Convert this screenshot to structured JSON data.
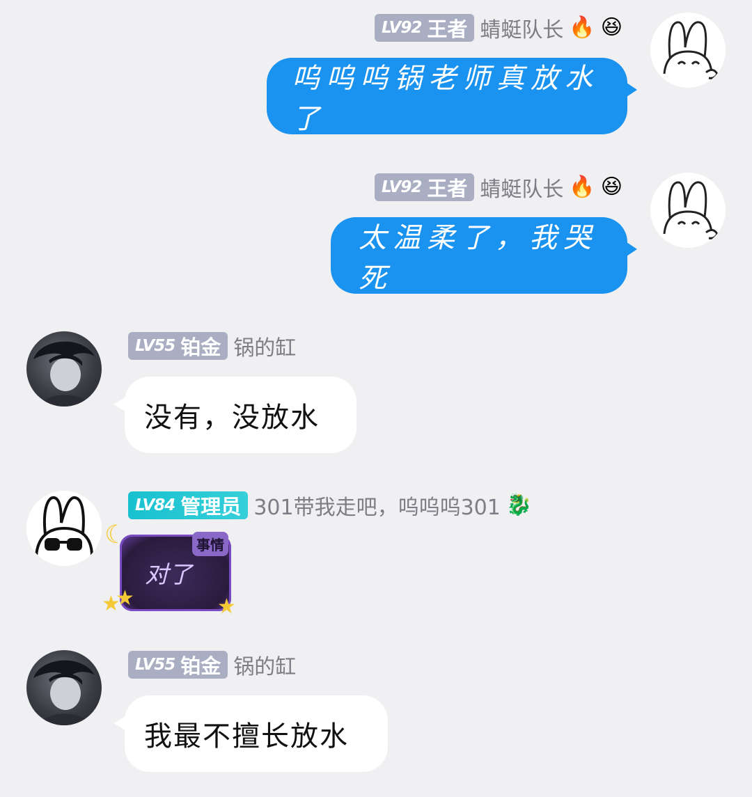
{
  "messages": [
    {
      "sender": {
        "level": "LV92",
        "rank": "王者",
        "nickname": "蜻蜓队长",
        "emojis": [
          "🔥",
          "😆"
        ],
        "avatar_icon": "bunny-avatar-icon"
      },
      "text": "呜呜呜锅老师真放水了",
      "direction": "outgoing"
    },
    {
      "sender": {
        "level": "LV92",
        "rank": "王者",
        "nickname": "蜻蜓队长",
        "emojis": [
          "🔥",
          "😆"
        ],
        "avatar_icon": "bunny-avatar-icon"
      },
      "text": "太温柔了，我哭死",
      "direction": "outgoing"
    },
    {
      "sender": {
        "level": "LV55",
        "rank": "铂金",
        "nickname": "锅的缸",
        "avatar_icon": "anime-avatar-icon"
      },
      "text": "没有，没放水",
      "direction": "incoming"
    },
    {
      "sender": {
        "level": "LV84",
        "rank": "管理员",
        "nickname": "301带我走吧，呜呜呜301",
        "emojis": [
          "🐉"
        ],
        "avatar_icon": "bunny-sunglasses-avatar-icon"
      },
      "sticker": {
        "text": "对了",
        "tag": "事情"
      },
      "direction": "incoming"
    },
    {
      "sender": {
        "level": "LV55",
        "rank": "铂金",
        "nickname": "锅的缸",
        "avatar_icon": "anime-avatar-icon"
      },
      "text": "我最不擅长放水",
      "direction": "incoming"
    }
  ],
  "colors": {
    "background": "#f0f0f2",
    "outgoing_bubble": "#1a93f0",
    "incoming_bubble": "#ffffff",
    "level_badge": "#a9aec2",
    "admin_badge": "#19c1d0"
  }
}
